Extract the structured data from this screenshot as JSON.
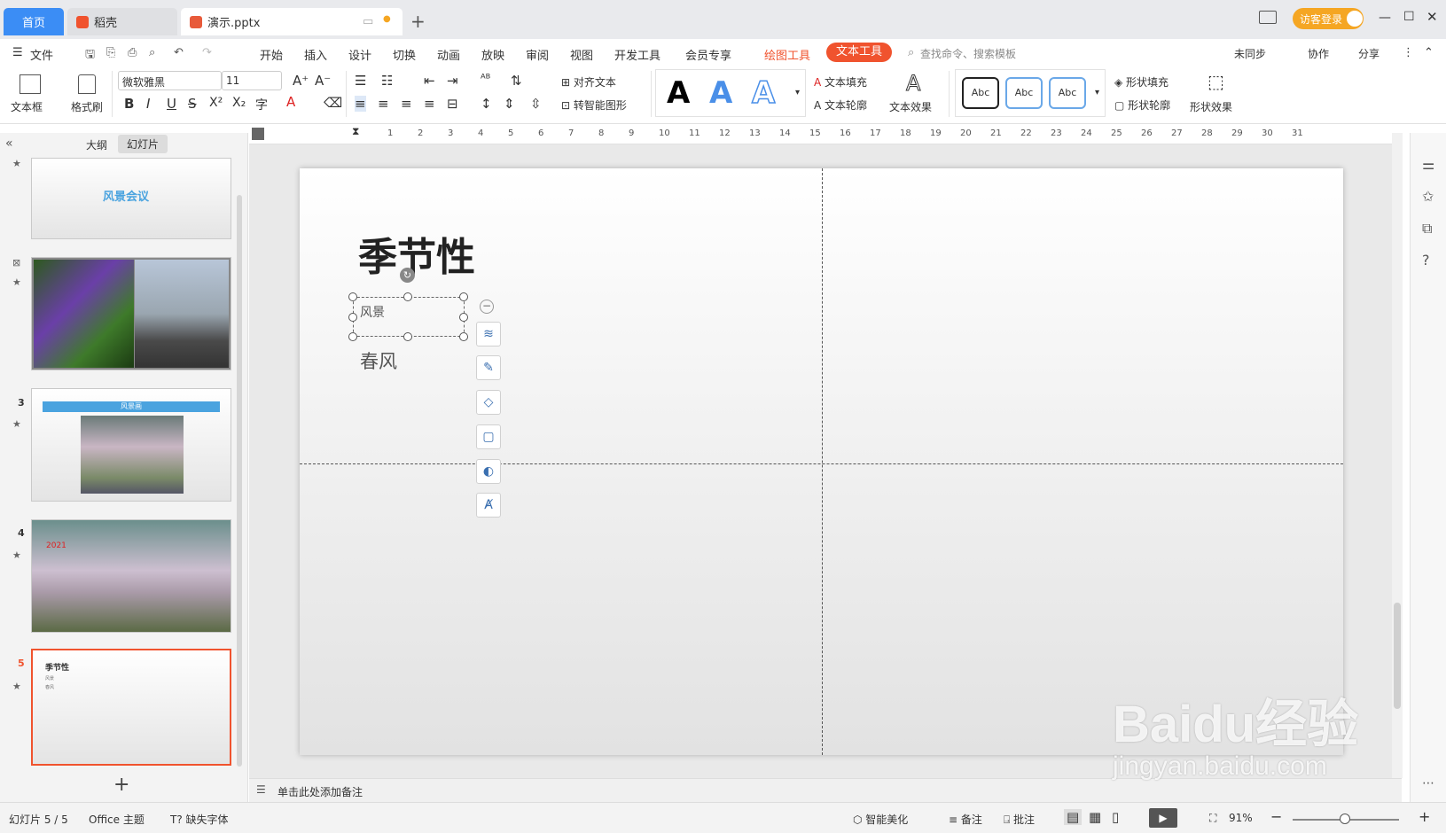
{
  "tabs": {
    "home": "首页",
    "daoke": "稻壳",
    "file": "演示.pptx"
  },
  "titlebar": {
    "login": "访客登录"
  },
  "menu": {
    "file": "文件",
    "items": [
      "开始",
      "插入",
      "设计",
      "切换",
      "动画",
      "放映",
      "审阅",
      "视图",
      "开发工具",
      "会员专享"
    ],
    "draw_tools": "绘图工具",
    "text_tools": "文本工具",
    "search": "查找命令、搜索模板",
    "unsync": "未同步",
    "collab": "协作",
    "share": "分享"
  },
  "ribbon": {
    "textbox": "文本框",
    "painter": "格式刷",
    "font": "微软雅黑",
    "size": "11",
    "bold": "B",
    "italic": "I",
    "underline": "U",
    "strike": "S",
    "sup": "X²",
    "sub": "X₂",
    "align_text": "对齐文本",
    "smart_shape": "转智能图形",
    "text_fill": "文本填充",
    "text_outline": "文本轮廓",
    "text_effect": "文本效果",
    "abc": "Abc",
    "shape_fill": "形状填充",
    "shape_outline": "形状轮廓",
    "shape_effect": "形状效果",
    "wordart": "A"
  },
  "panel": {
    "outline": "大纲",
    "slides": "幻灯片",
    "add": "+"
  },
  "thumbs": {
    "t1": "风景会议",
    "t3": "风景画",
    "t4": "2021",
    "t5_title": "季节性",
    "t5_l1": "风景",
    "t5_l2": "春风",
    "n3": "3",
    "n4": "4",
    "n5": "5"
  },
  "ruler": [
    "1",
    "2",
    "3",
    "4",
    "5",
    "6",
    "7",
    "8",
    "9",
    "10",
    "11",
    "12",
    "13",
    "14",
    "15",
    "16",
    "17",
    "18",
    "19",
    "20",
    "21",
    "22",
    "23",
    "24",
    "25",
    "26",
    "27",
    "28",
    "29",
    "30",
    "31"
  ],
  "slide": {
    "title": "季节性",
    "line1": "风景",
    "line2": "春风"
  },
  "notes": "单击此处添加备注",
  "status": {
    "slide": "幻灯片 5 / 5",
    "theme": "Office 主题",
    "missing": "缺失字体",
    "beautify": "智能美化",
    "notes": "备注",
    "comment": "批注",
    "zoom": "91%"
  },
  "watermark": {
    "brand": "Baidu经验",
    "url": "jingyan.baidu.com"
  },
  "colors": {
    "accent": "#3b8df5",
    "orange": "#f0532e",
    "tab_active": "#f0532e"
  }
}
